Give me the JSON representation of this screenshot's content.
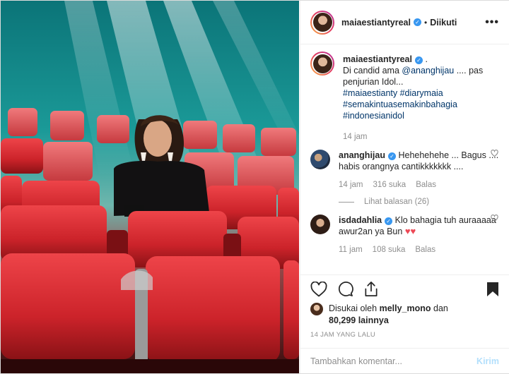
{
  "header": {
    "username": "maiaestiantyreal",
    "separator": "•",
    "follow_status": "Diikuti",
    "more": "•••"
  },
  "caption": {
    "username": "maiaestiantyreal",
    "suffix": ".",
    "text_1": "Di candid ama ",
    "mention": "@ananghijau",
    "text_2": " .... pas penjurian Idol...",
    "hashtags": [
      "#maiaestianty",
      "#diarymaia",
      "#semakintuasemakinbahagia",
      "#indonesianidol"
    ],
    "time": "14 jam"
  },
  "comments": [
    {
      "username": "ananghijau",
      "text": "Hehehehehe ... Bagus .... habis orangnya cantikkkkkkk ....",
      "time": "14 jam",
      "likes": "316 suka",
      "reply": "Balas",
      "view_replies": "Lihat balasan (26)"
    },
    {
      "username": "isdadahlia",
      "text": "Klo bahagia tuh auraaaaa awur2an ya Bun ",
      "emoji": "♥♥",
      "time": "11 jam",
      "likes": "108 suka",
      "reply": "Balas"
    }
  ],
  "likes": {
    "prefix": "Disukai oleh ",
    "user": "melly_mono",
    "middle": " dan",
    "count": "80,299 lainnya"
  },
  "timestamp": "14 JAM YANG LALU",
  "add_comment": {
    "placeholder": "Tambahkan komentar...",
    "send": "Kirim"
  },
  "colors": {
    "accent_blue": "#3897f0",
    "heart_red": "#ed4956",
    "muted_text": "#8e8e8e",
    "seat_red": "#d7282e"
  },
  "icons": [
    "verified-icon",
    "heart-icon",
    "comment-icon",
    "share-icon",
    "bookmark-icon"
  ]
}
